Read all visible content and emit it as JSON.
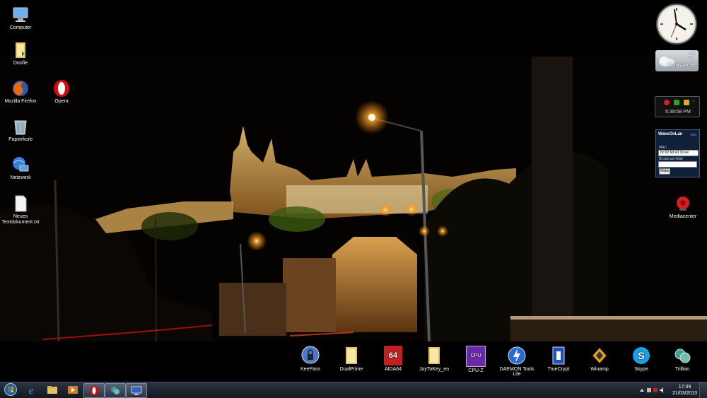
{
  "desktop_icons": [
    {
      "label": "Computer",
      "icon": "computer-icon"
    },
    {
      "label": "Doofie",
      "icon": "folder-icon"
    },
    {
      "label": "Mozilla Firefox",
      "icon": "firefox-icon"
    },
    {
      "label": "Opera",
      "icon": "opera-icon"
    },
    {
      "label": "Papierkorb",
      "icon": "recycle-bin-icon"
    },
    {
      "label": "Netzwerk",
      "icon": "network-icon"
    },
    {
      "label": "Neues Textdokument.txt",
      "icon": "text-document-icon"
    },
    {
      "label": "Mediacenter",
      "icon": "media-center-icon"
    }
  ],
  "dock": [
    {
      "label": "KeePass",
      "icon": "keepass-icon"
    },
    {
      "label": "DualPrime",
      "icon": "folder-icon"
    },
    {
      "label": "AIDA64",
      "icon": "aida64-icon",
      "badge": "64"
    },
    {
      "label": "JoyToKey_en",
      "icon": "folder-icon"
    },
    {
      "label": "CPU-Z",
      "icon": "cpu-z-icon",
      "badge": "CPU"
    },
    {
      "label": "DAEMON Tools Lite",
      "icon": "daemon-tools-icon"
    },
    {
      "label": "TrueCrypt",
      "icon": "truecrypt-icon"
    },
    {
      "label": "Winamp",
      "icon": "winamp-icon"
    },
    {
      "label": "Skype",
      "icon": "skype-icon"
    },
    {
      "label": "Trillian",
      "icon": "trillian-icon"
    }
  ],
  "gadgets": {
    "weather": {
      "temp": "4°",
      "city": "Pfungstadt, HE"
    },
    "netmon": {
      "time": "5:39:58 PM"
    },
    "wakeonlan": {
      "title": "WakeOnLan",
      "help": "help",
      "mac_label": "MAC",
      "mac_value": "6c:62:6d:43:1b:ee",
      "broadcast_label": "Broadcast Addr",
      "broadcast_value": "",
      "wake_label": "Wake"
    }
  },
  "taskbar": {
    "buttons": [
      {
        "name": "start-button",
        "icon": "windows-start-icon"
      },
      {
        "name": "internet-explorer",
        "icon": "ie-icon"
      },
      {
        "name": "explorer",
        "icon": "folder-icon"
      },
      {
        "name": "media-player",
        "icon": "media-player-icon"
      },
      {
        "name": "opera",
        "icon": "opera-icon",
        "active": true
      },
      {
        "name": "trillian",
        "icon": "trillian-icon",
        "active": true
      },
      {
        "name": "remote-desktop",
        "icon": "remote-desktop-icon",
        "active": true
      }
    ],
    "clock_time": "17:39",
    "clock_date": "21/03/2013"
  },
  "colors": {
    "taskbar": "#1b222c",
    "wol_bg": "#10203a",
    "opera_red": "#cc1010"
  }
}
